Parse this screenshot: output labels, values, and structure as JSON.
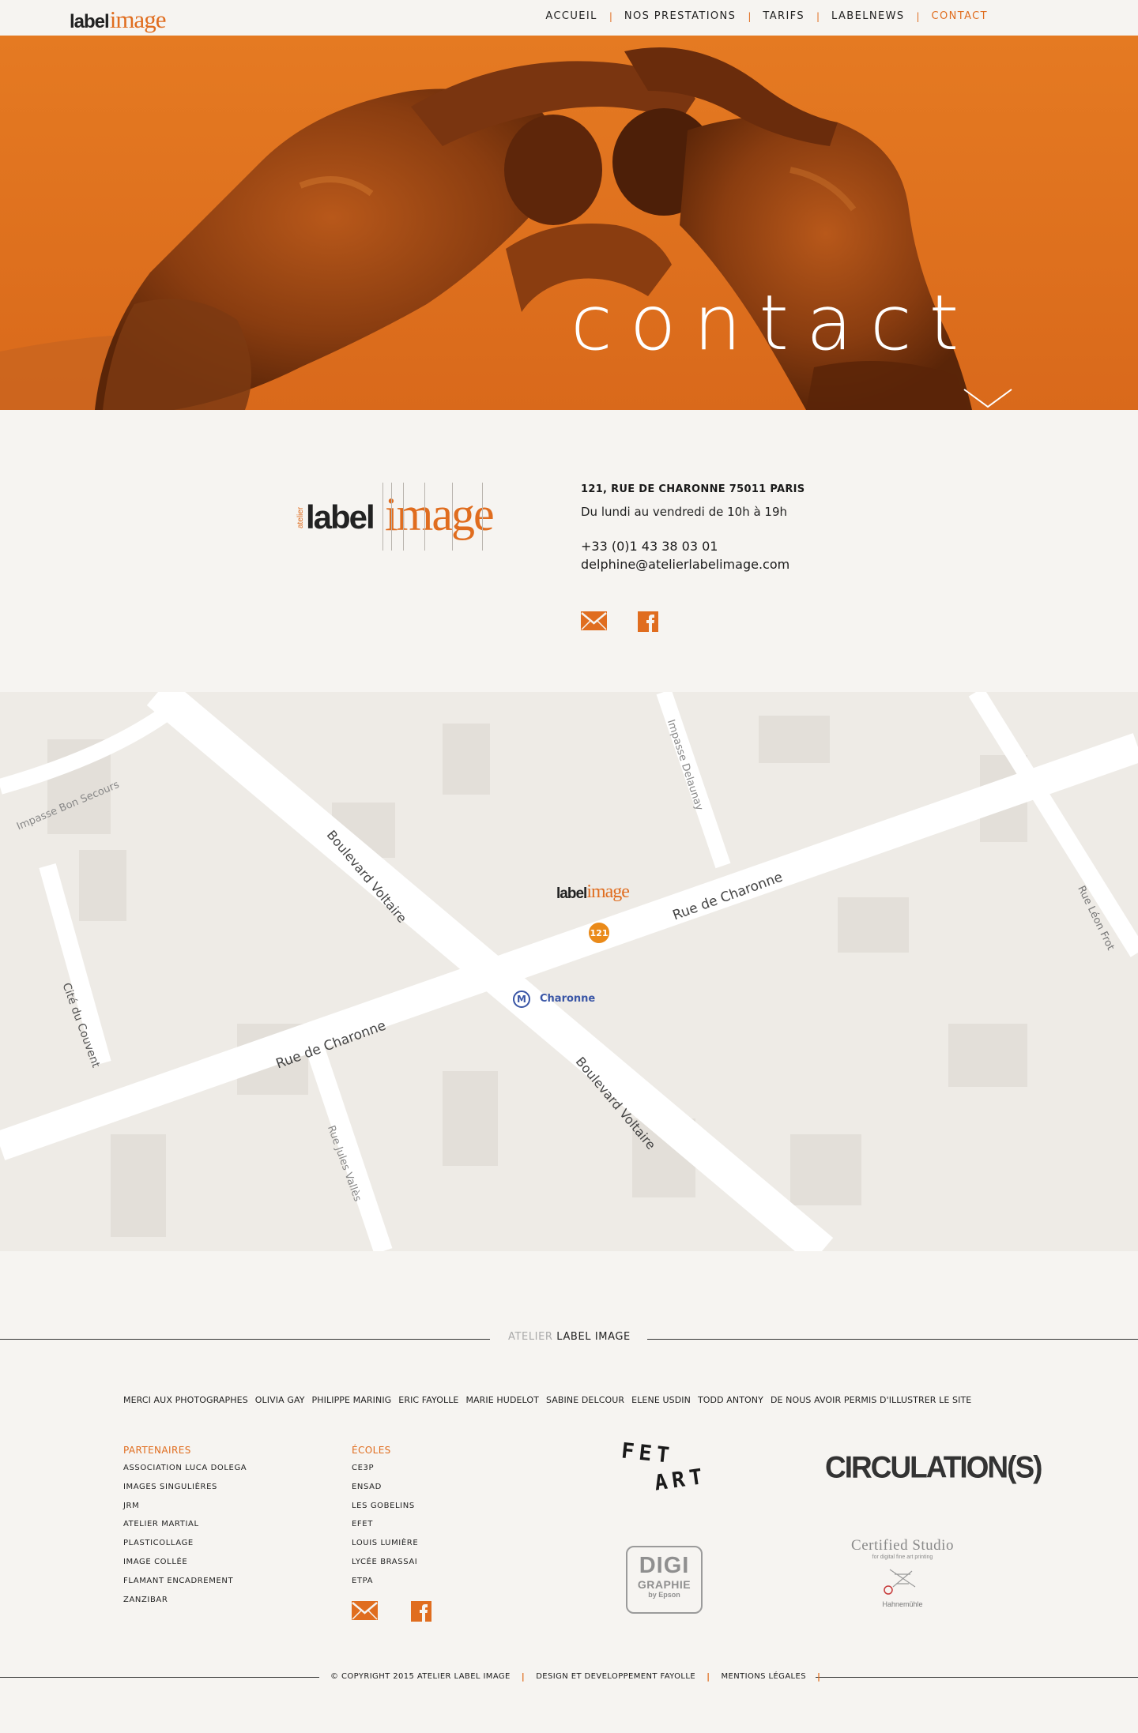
{
  "nav": {
    "logo": {
      "part1": "label",
      "part2": "image"
    },
    "items": [
      {
        "label": "ACCUEIL"
      },
      {
        "label": "NOS PRESTATIONS"
      },
      {
        "label": "TARIFS"
      },
      {
        "label": "LABELNEWS"
      },
      {
        "label": "CONTACT"
      }
    ],
    "active": "CONTACT"
  },
  "hero": {
    "title": "contact",
    "chevron_icon": "chevron-down-icon",
    "background": "#e0731d"
  },
  "contact": {
    "logo": {
      "atelier": "atelier",
      "part1": "label",
      "part2": "image"
    },
    "address": "121, RUE DE CHARONNE 75011 PARIS",
    "hours": "Du lundi au vendredi de 10h à 19h",
    "phone": "+33 (0)1 43 38 03 01",
    "email": "delphine@atelierlabelimage.com",
    "icons": [
      "mail-icon",
      "facebook-icon"
    ]
  },
  "map": {
    "streets": {
      "impasse_bon_secours": "Impasse Bon Secours",
      "boulevard_voltaire": "Boulevard Voltaire",
      "impasse_delaunay": "Impasse Delaunay",
      "rue_de_charonne": "Rue de Charonne",
      "rue_leon_frot": "Rue Léon Frot",
      "cite_du_couvent": "Cité du Couvent",
      "rue_jules_valles": "Rue Jules Vallès"
    },
    "pin_number": "121",
    "metro_symbol": "M",
    "metro_station": "Charonne",
    "logo": {
      "part1": "label",
      "part2": "image"
    }
  },
  "footer": {
    "brand_light": "ATELIER",
    "brand_dark": "LABEL IMAGE",
    "thanks": [
      "MERCI AUX PHOTOGRAPHES",
      "OLIVIA GAY",
      "PHILIPPE MARINIG",
      "ERIC FAYOLLE",
      "MARIE HUDELOT",
      "SABINE DELCOUR",
      "ELENE USDIN",
      "TODD ANTONY",
      "DE NOUS AVOIR PERMIS D'ILLUSTRER LE SITE"
    ],
    "partners_title": "PARTENAIRES",
    "partners": [
      "ASSOCIATION LUCA DOLEGA",
      "IMAGES SINGULIÈRES",
      "JRM",
      "ATELIER MARTIAL",
      "PLASTICOLLAGE",
      "IMAGE COLLÉE",
      "FLAMANT ENCADREMENT",
      "ZANZIBAR"
    ],
    "schools_title": "ÉCOLES",
    "schools": [
      "CE3P",
      "ENSAD",
      "LES GOBELINS",
      "EFET",
      "LOUIS LUMIÈRE",
      "LYCÉE BRASSAI",
      "ETPA"
    ],
    "sponsors": {
      "fetart_1": "FET",
      "fetart_2": "ART",
      "circulations": "CIRCULATION(S)",
      "digi_1": "DIGI",
      "digi_2": "GRAPHIE",
      "digi_3": "by Epson",
      "cert_1": "Certified Studio",
      "cert_2": "for digital fine art printing",
      "cert_3": "Hahnemühle"
    },
    "legal": {
      "copyright": "© COPYRIGHT 2015 ATELIER LABEL IMAGE",
      "design": "DESIGN ET DEVELOPPEMENT FAYOLLE",
      "mentions": "MENTIONS LÉGALES"
    }
  },
  "colors": {
    "accent": "#e06d1f",
    "background": "#f6f4f1",
    "text": "#1a1a1a"
  }
}
